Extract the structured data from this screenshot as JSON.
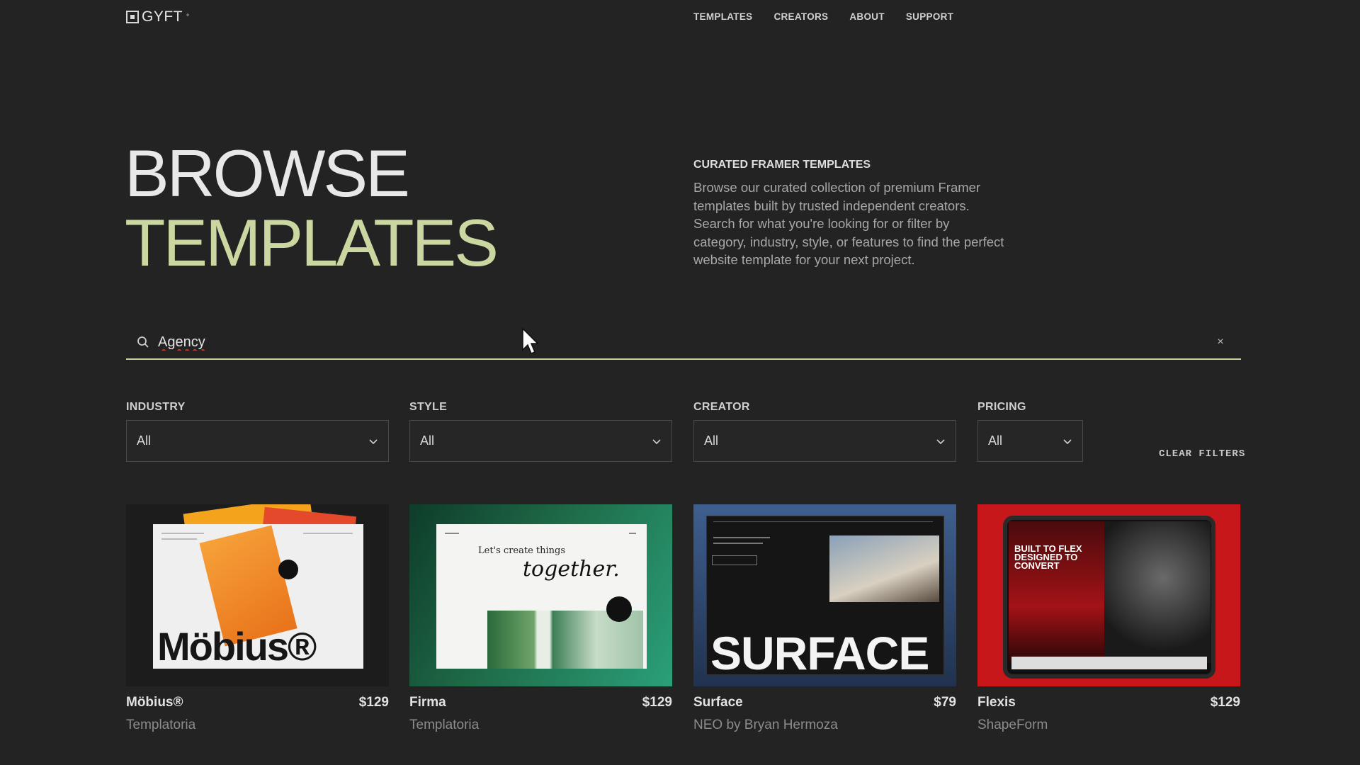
{
  "header": {
    "logo_text": "GYFT",
    "logo_mark": "°",
    "nav": [
      "TEMPLATES",
      "CREATORS",
      "ABOUT",
      "SUPPORT"
    ]
  },
  "hero": {
    "title_line1": "BROWSE",
    "title_line2": "TEMPLATES",
    "side_heading": "CURATED FRAMER TEMPLATES",
    "side_text": "Browse our curated collection of premium Framer templates built by trusted independent creators. Search for what you're looking for or filter by category, industry, style, or features to find the perfect website template for your next project."
  },
  "search": {
    "value": "Agency",
    "clear_label": "×"
  },
  "filters": [
    {
      "label": "INDUSTRY",
      "value": "All"
    },
    {
      "label": "STYLE",
      "value": "All"
    },
    {
      "label": "CREATOR",
      "value": "All"
    },
    {
      "label": "PRICING",
      "value": "All"
    }
  ],
  "clear_filters": "CLEAR FILTERS",
  "templates": [
    {
      "name": "Möbius®",
      "price": "$129",
      "creator": "Templatoria",
      "thumb_text": "Möbius®"
    },
    {
      "name": "Firma",
      "price": "$129",
      "creator": "Templatoria",
      "thumb_text_1": "Let's create things",
      "thumb_text_2": "together."
    },
    {
      "name": "Surface",
      "price": "$79",
      "creator": "NEO by Bryan Hermoza",
      "thumb_text": "SURFACE"
    },
    {
      "name": "Flexis",
      "price": "$129",
      "creator": "ShapeForm",
      "thumb_text": "BUILT TO FLEX DESIGNED TO CONVERT"
    }
  ],
  "colors": {
    "background": "#232323",
    "accent": "#c6d29b",
    "text": "#d8d8d8"
  }
}
